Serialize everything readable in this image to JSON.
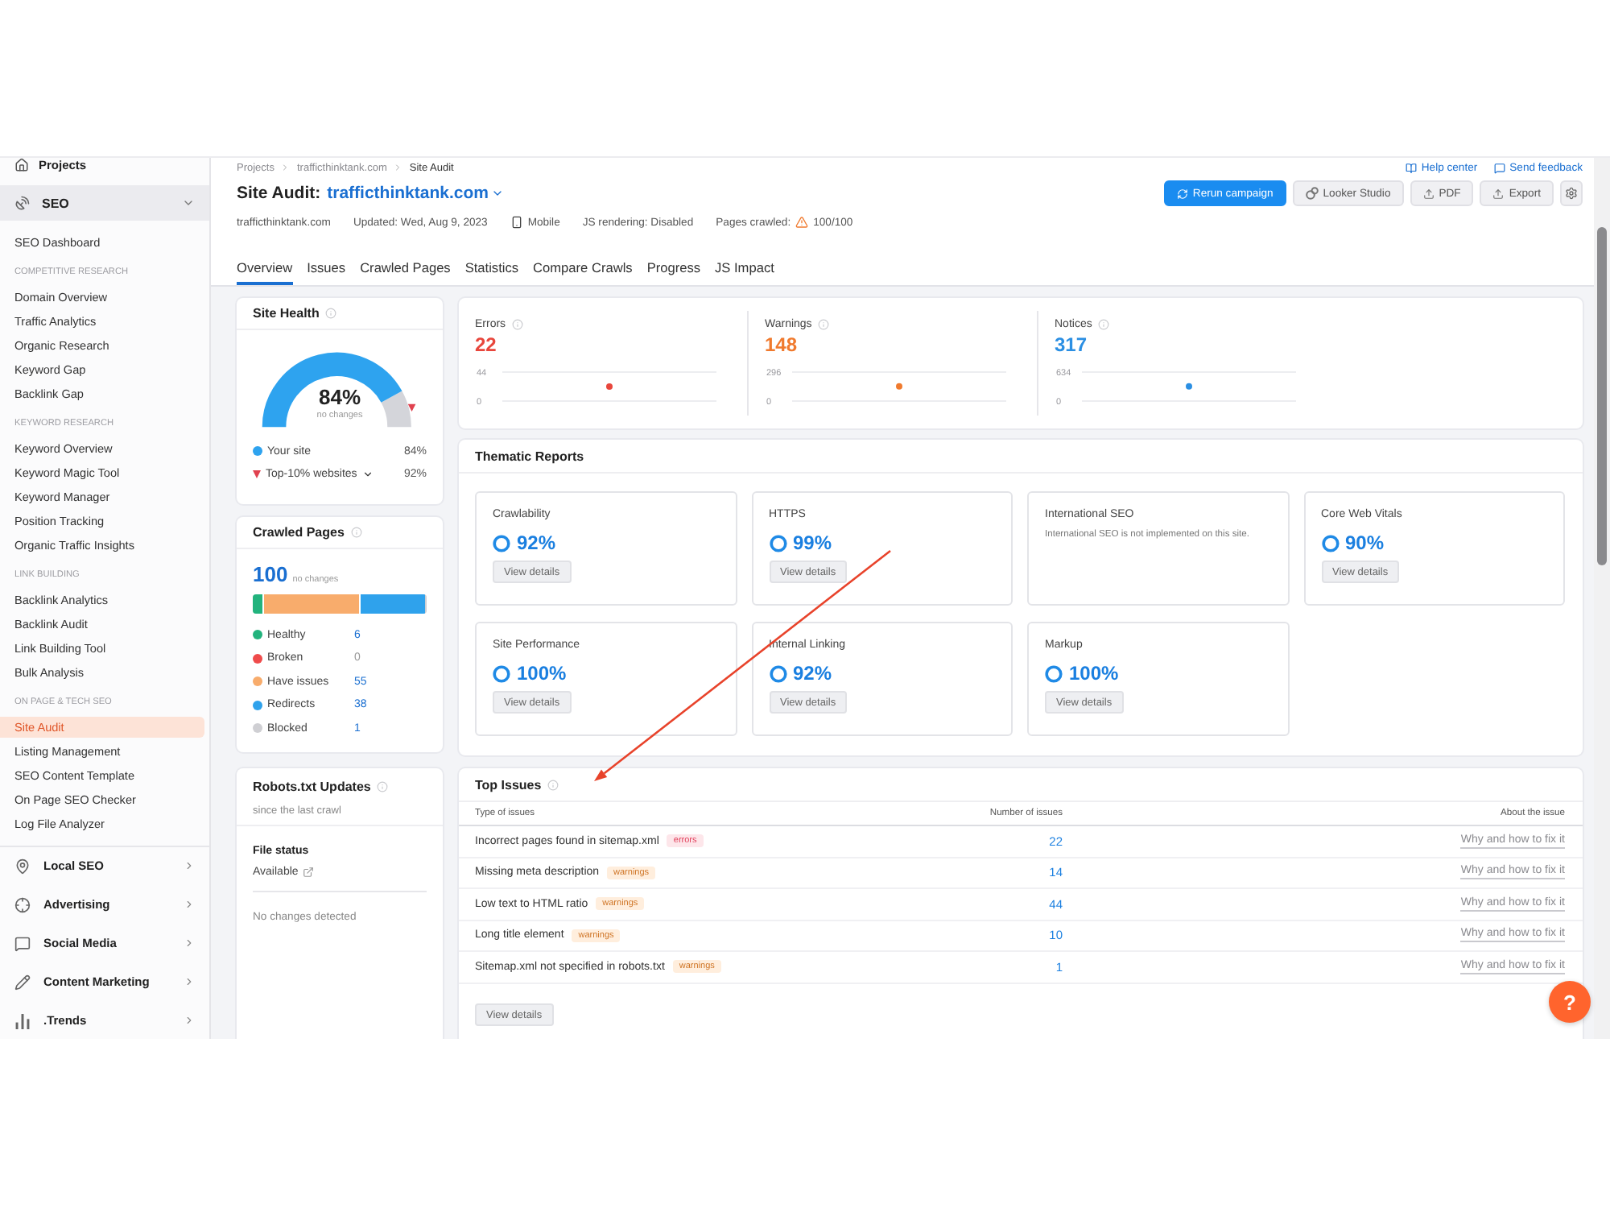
{
  "sidebar": {
    "projects": {
      "label": "Projects"
    },
    "seo": {
      "label": "SEO",
      "expanded": true,
      "dashboard": {
        "label": "SEO Dashboard",
        "selected": false
      },
      "sections": [
        {
          "heading": "COMPETITIVE RESEARCH",
          "items": [
            {
              "label": "Domain Overview",
              "selected": false
            },
            {
              "label": "Traffic Analytics",
              "selected": false
            },
            {
              "label": "Organic Research",
              "selected": false
            },
            {
              "label": "Keyword Gap",
              "selected": false
            },
            {
              "label": "Backlink Gap",
              "selected": false
            }
          ]
        },
        {
          "heading": "KEYWORD RESEARCH",
          "items": [
            {
              "label": "Keyword Overview",
              "selected": false
            },
            {
              "label": "Keyword Magic Tool",
              "selected": false
            },
            {
              "label": "Keyword Manager",
              "selected": false
            },
            {
              "label": "Position Tracking",
              "selected": false
            },
            {
              "label": "Organic Traffic Insights",
              "selected": false
            }
          ]
        },
        {
          "heading": "LINK BUILDING",
          "items": [
            {
              "label": "Backlink Analytics",
              "selected": false
            },
            {
              "label": "Backlink Audit",
              "selected": false
            },
            {
              "label": "Link Building Tool",
              "selected": false
            },
            {
              "label": "Bulk Analysis",
              "selected": false
            }
          ]
        },
        {
          "heading": "ON PAGE & TECH SEO",
          "items": [
            {
              "label": "Site Audit",
              "selected": true
            },
            {
              "label": "Listing Management",
              "selected": false
            },
            {
              "label": "SEO Content Template",
              "selected": false
            },
            {
              "label": "On Page SEO Checker",
              "selected": false
            },
            {
              "label": "Log File Analyzer",
              "selected": false
            }
          ]
        }
      ]
    },
    "groups": [
      {
        "label": "Local SEO",
        "expanded": false
      },
      {
        "label": "Advertising",
        "expanded": false
      },
      {
        "label": "Social Media",
        "expanded": false
      },
      {
        "label": "Content Marketing",
        "expanded": false
      },
      {
        "label": ".Trends",
        "expanded": false
      }
    ]
  },
  "header": {
    "breadcrumbs": [
      {
        "label": "Projects",
        "current": false
      },
      {
        "label": "trafficthinktank.com",
        "current": false
      },
      {
        "label": "Site Audit",
        "current": true
      }
    ],
    "help_links": [
      {
        "label": "Help center"
      },
      {
        "label": "Send feedback"
      }
    ],
    "title": "Site Audit:",
    "project": "trafficthinktank.com",
    "actions": [
      {
        "label": "Rerun campaign",
        "kind": "primary"
      },
      {
        "label": "Looker Studio",
        "kind": "secondary"
      },
      {
        "label": "PDF",
        "kind": "secondary"
      },
      {
        "label": "Export",
        "kind": "secondary"
      }
    ],
    "meta": {
      "domain": "trafficthinktank.com",
      "updated": "Updated: Wed, Aug 9, 2023",
      "device": "Mobile",
      "js_rendering": "JS rendering: Disabled",
      "pages_crawled": {
        "label": "Pages crawled:",
        "value": "100/100",
        "warning": true
      }
    }
  },
  "tabs": [
    {
      "label": "Overview",
      "selected": true
    },
    {
      "label": "Issues",
      "selected": false
    },
    {
      "label": "Crawled Pages",
      "selected": false
    },
    {
      "label": "Statistics",
      "selected": false
    },
    {
      "label": "Compare Crawls",
      "selected": false
    },
    {
      "label": "Progress",
      "selected": false
    },
    {
      "label": "JS Impact",
      "selected": false
    }
  ],
  "site_health": {
    "title": "Site Health",
    "score": "84%",
    "change": "no changes",
    "legend": [
      {
        "kind": "dot",
        "label": "Your site",
        "value": "84%",
        "color": "#2ea3ef"
      },
      {
        "kind": "marker",
        "label": "Top-10% websites",
        "value": "92%",
        "color": "#e0414f"
      }
    ]
  },
  "crawled_pages": {
    "title": "Crawled Pages",
    "total": "100",
    "change": "no changes",
    "statuses": [
      {
        "label": "Healthy",
        "count": "6",
        "color": "#22b37d",
        "disabled": false
      },
      {
        "label": "Broken",
        "count": "0",
        "color": "#ef4b4b",
        "disabled": true
      },
      {
        "label": "Have issues",
        "count": "55",
        "color": "#f8ac6c",
        "disabled": false
      },
      {
        "label": "Redirects",
        "count": "38",
        "color": "#2fa2ec",
        "disabled": false
      },
      {
        "label": "Blocked",
        "count": "1",
        "color": "#cfcfd3",
        "disabled": false
      }
    ]
  },
  "robots_txt": {
    "title": "Robots.txt Updates",
    "subtitle": "since the last crawl",
    "file_status_label": "File status",
    "file_status": "Available",
    "changes": "No changes detected"
  },
  "issue_totals": [
    {
      "label": "Errors",
      "count": "22",
      "color": "#e8463c",
      "chart_data": {
        "type": "scatter",
        "ylim": [
          0,
          44
        ],
        "yticks": [
          0,
          44
        ],
        "series": [
          {
            "color": "#e8463c",
            "values": [
              22
            ]
          }
        ]
      }
    },
    {
      "label": "Warnings",
      "count": "148",
      "color": "#f07a2e",
      "chart_data": {
        "type": "scatter",
        "ylim": [
          0,
          296
        ],
        "yticks": [
          0,
          296
        ],
        "series": [
          {
            "color": "#f07a2e",
            "values": [
              150
            ]
          }
        ]
      }
    },
    {
      "label": "Notices",
      "count": "317",
      "color": "#2b8fe3",
      "chart_data": {
        "type": "scatter",
        "ylim": [
          0,
          634
        ],
        "yticks": [
          0,
          634
        ],
        "series": [
          {
            "color": "#2b8fe3",
            "values": [
              320
            ]
          }
        ]
      }
    }
  ],
  "thematic_reports": {
    "title": "Thematic Reports",
    "reports": [
      {
        "kind": "score",
        "name": "Crawlability",
        "score": "92%",
        "button": "View details"
      },
      {
        "kind": "score",
        "name": "HTTPS",
        "score": "99%",
        "button": "View details"
      },
      {
        "kind": "note",
        "name": "International SEO",
        "note": "International SEO is not implemented on this site."
      },
      {
        "kind": "score",
        "name": "Core Web Vitals",
        "score": "90%",
        "button": "View details"
      },
      {
        "kind": "score",
        "name": "Site Performance",
        "score": "100%",
        "button": "View details"
      },
      {
        "kind": "score",
        "name": "Internal Linking",
        "score": "92%",
        "button": "View details"
      },
      {
        "kind": "score",
        "name": "Markup",
        "score": "100%",
        "button": "View details"
      }
    ]
  },
  "top_issues": {
    "title": "Top Issues",
    "columns": [
      "Type of issues",
      "Number of issues",
      "About the issue"
    ],
    "rows": [
      {
        "issue": "Incorrect pages found in sitemap.xml",
        "tag": {
          "label": "errors",
          "kind": "error"
        },
        "count": "22",
        "link": "Why and how to fix it"
      },
      {
        "issue": "Missing meta description",
        "tag": {
          "label": "warnings",
          "kind": "warning"
        },
        "count": "14",
        "link": "Why and how to fix it"
      },
      {
        "issue": "Low text to HTML ratio",
        "tag": {
          "label": "warnings",
          "kind": "warning"
        },
        "count": "44",
        "link": "Why and how to fix it"
      },
      {
        "issue": "Long title element",
        "tag": {
          "label": "warnings",
          "kind": "warning"
        },
        "count": "10",
        "link": "Why and how to fix it"
      },
      {
        "issue": "Sitemap.xml not specified in robots.txt",
        "tag": {
          "label": "warnings",
          "kind": "warning"
        },
        "count": "1",
        "link": "Why and how to fix it"
      }
    ],
    "button": "View details"
  },
  "help_button": {
    "label": "?"
  }
}
